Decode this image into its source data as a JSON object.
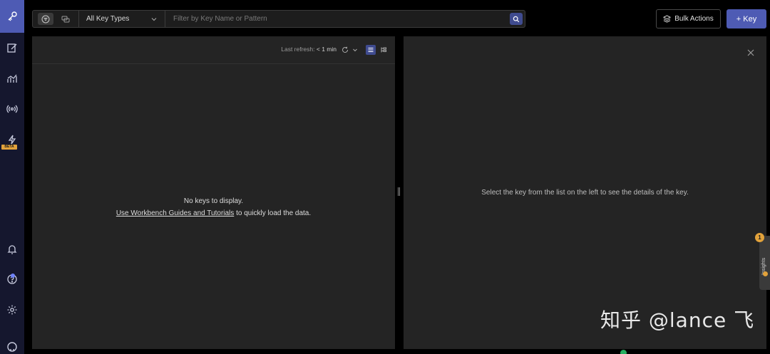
{
  "sidebar": {
    "items": [
      {
        "icon": "key-icon",
        "active": true
      },
      {
        "icon": "edit-icon"
      },
      {
        "icon": "analytics-icon"
      },
      {
        "icon": "pubsub-icon"
      },
      {
        "icon": "triggers-icon",
        "badge": "BETA"
      }
    ],
    "bottom": [
      {
        "icon": "bell-icon"
      },
      {
        "icon": "help-icon"
      },
      {
        "icon": "gear-icon"
      },
      {
        "icon": "github-icon"
      }
    ]
  },
  "toolbar": {
    "key_type_value": "All Key Types",
    "search_placeholder": "Filter by Key Name or Pattern",
    "bulk_actions_label": "Bulk Actions",
    "add_key_label": "+ Key"
  },
  "keys_panel": {
    "refresh_label": "Last refresh:",
    "refresh_value": "< 1 min",
    "empty_title": "No keys to display.",
    "empty_link": "Use Workbench Guides and Tutorials",
    "empty_suffix": " to quickly load the data."
  },
  "details_panel": {
    "message": "Select the key from the list on the left to see the details of the key."
  },
  "insights": {
    "label": "Insights",
    "count": "1"
  },
  "watermark": "知乎 @lance 飞"
}
